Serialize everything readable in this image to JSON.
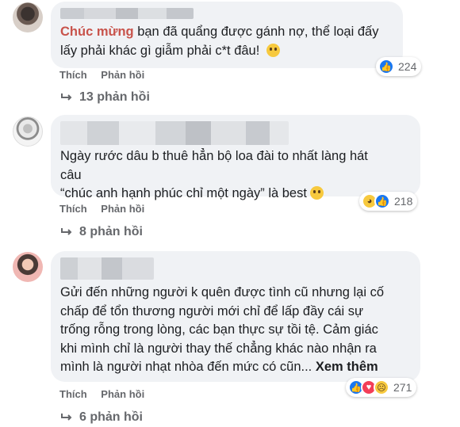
{
  "comments": [
    {
      "text_highlight": "Chúc mừng",
      "text": " bạn đã quẩng được gánh nợ, thể loại đấy\nlấy phải khác gì giẫm phải c*t đâu! ",
      "actions": {
        "like": "Thích",
        "reply": "Phản hồi"
      },
      "reactions": {
        "icons": [
          "like-icon"
        ],
        "count": "224"
      },
      "replies": "13 phản hồi"
    },
    {
      "text": "Ngày rước dâu b thuê hẳn bộ loa đài to nhất làng hát\ncâu\n“chúc anh hạnh phúc chỉ một ngày” là best",
      "actions": {
        "like": "Thích",
        "reply": "Phản hồi"
      },
      "reactions": {
        "icons": [
          "haha-icon",
          "like-icon"
        ],
        "count": "218"
      },
      "replies": "8 phản hồi"
    },
    {
      "text": "Gửi đến những người k quên được tình cũ nhưng lại cố\nchấp để tổn thương người mới chỉ để lấp đầy cái sự\ntrống rỗng trong lòng, các bạn thực sự tồi tệ. Cảm giác\nkhi mình chỉ là người thay thế chẳng khác nào nhận ra\nmình là người nhạt nhòa đến mức có cũn... ",
      "see_more": "Xem thêm",
      "actions": {
        "like": "Thích",
        "reply": "Phản hồi"
      },
      "reactions": {
        "icons": [
          "like-icon",
          "love-icon",
          "sad-icon"
        ],
        "count": "271"
      },
      "replies": "6 phản hồi"
    }
  ],
  "colors": {
    "highlight": "#c8534b",
    "bubble": "#f0f2f5",
    "like": "#1877f2",
    "love": "#f33e58",
    "muted": "#65676b"
  }
}
